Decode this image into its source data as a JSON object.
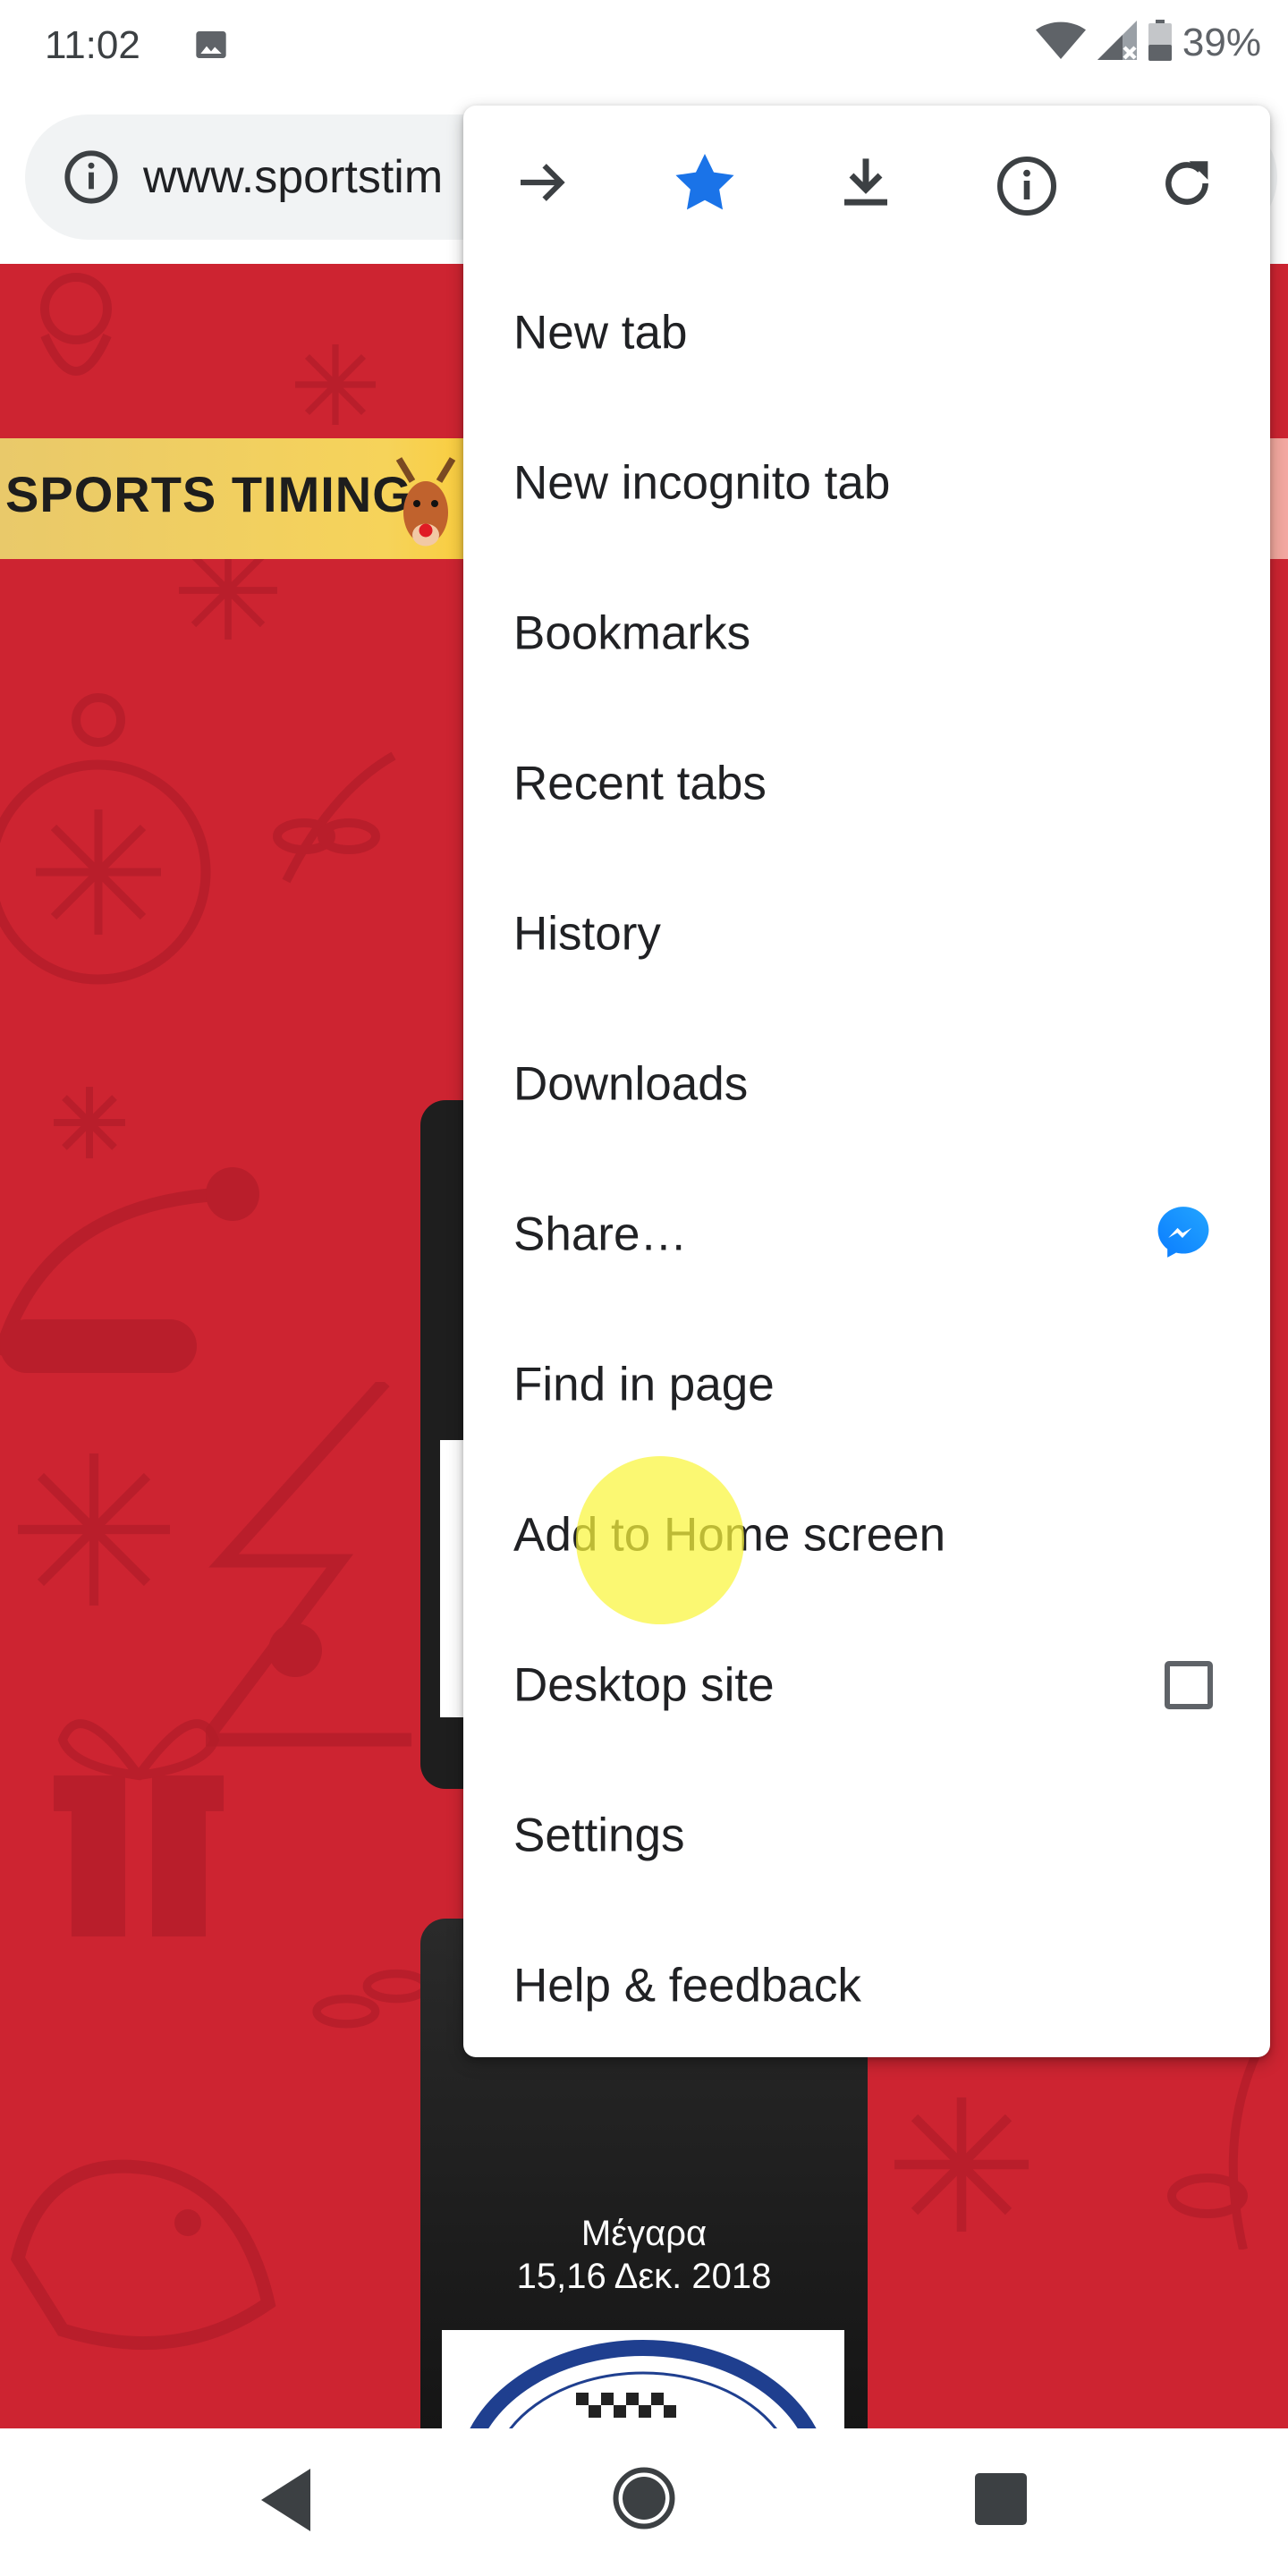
{
  "status_bar": {
    "time": "11:02",
    "battery": "39%"
  },
  "address_bar": {
    "url": "www.sportstim"
  },
  "page": {
    "banner_text": "SPORTS TIMING",
    "event_location": "Μέγαρα",
    "event_date": "15,16 Δεκ. 2018"
  },
  "menu": {
    "top_icons": [
      "forward-icon",
      "bookmark-star-icon",
      "download-icon",
      "info-icon",
      "reload-icon"
    ],
    "items": [
      {
        "label": "New tab"
      },
      {
        "label": "New incognito tab"
      },
      {
        "label": "Bookmarks"
      },
      {
        "label": "Recent tabs"
      },
      {
        "label": "History"
      },
      {
        "label": "Downloads"
      },
      {
        "label": "Share…",
        "trailing": "messenger-icon"
      },
      {
        "label": "Find in page"
      },
      {
        "label": "Add to Home screen"
      },
      {
        "label": "Desktop site",
        "trailing": "checkbox",
        "checked": false
      },
      {
        "label": "Settings"
      },
      {
        "label": "Help & feedback"
      }
    ]
  },
  "colors": {
    "accent": "#1a73e8",
    "page_bg": "#cd2431",
    "touch_indicator": "#faf53c"
  }
}
